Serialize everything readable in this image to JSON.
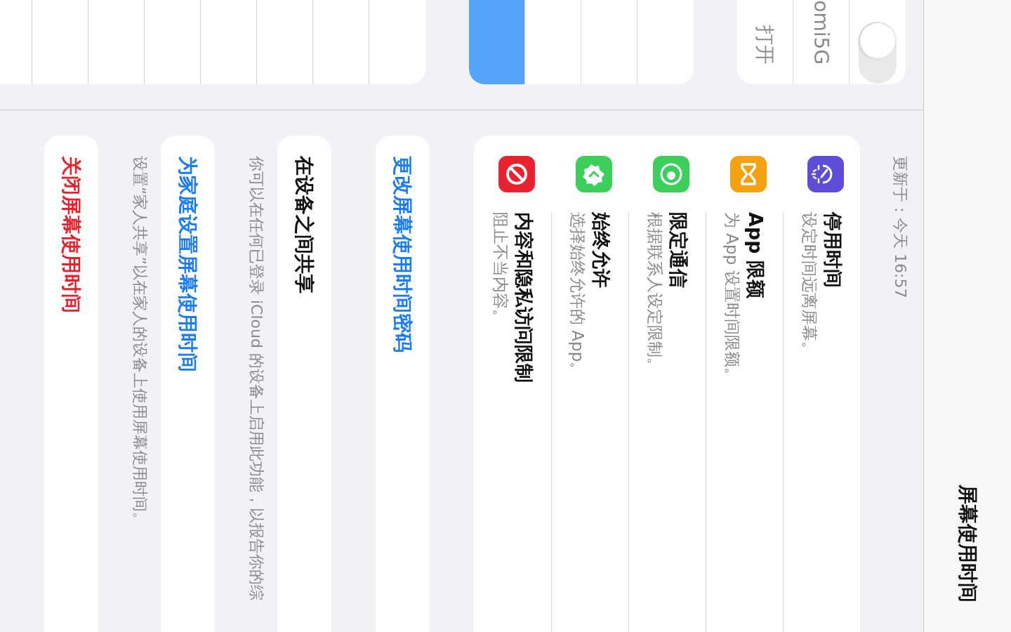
{
  "nav_bar": {
    "title": "屏幕使用时间"
  },
  "sidebar": {
    "groups": [
      {
        "rows": [
          {
            "kind": "toggle",
            "on": false
          },
          {
            "kind": "text",
            "text": "omi5G"
          },
          {
            "kind": "text",
            "text": "打开"
          }
        ]
      },
      {
        "rows": [
          {
            "kind": "blank",
            "selected": false
          },
          {
            "kind": "blank",
            "selected": false
          },
          {
            "kind": "blank",
            "selected": false
          },
          {
            "kind": "blank",
            "selected": true
          }
        ]
      },
      {
        "rows": [
          {
            "kind": "blank",
            "selected": false
          },
          {
            "kind": "blank",
            "selected": false
          },
          {
            "kind": "blank",
            "selected": false
          },
          {
            "kind": "blank",
            "selected": false
          },
          {
            "kind": "blank",
            "selected": false
          },
          {
            "kind": "blank",
            "selected": false
          },
          {
            "kind": "blank",
            "selected": false
          },
          {
            "kind": "blank",
            "selected": false
          }
        ]
      }
    ]
  },
  "updated": "更新于：今天 16:57",
  "features": [
    {
      "kind": "dial",
      "color": "#5a4fd6",
      "title": "停用时间",
      "subtitle": "设定时间远离屏幕。"
    },
    {
      "kind": "hourglass",
      "color": "#f5a00f",
      "title": "App 限额",
      "subtitle": "为 App 设置时间限额。"
    },
    {
      "kind": "contact",
      "color": "#3ccf5b",
      "title": "限定通信",
      "subtitle": "根据联系人设定限制。"
    },
    {
      "kind": "badge",
      "color": "#3ccf5b",
      "title": "始终允许",
      "subtitle": "选择始终允许的 App。"
    },
    {
      "kind": "block",
      "color": "#e8232f",
      "title": "内容和隐私访问限制",
      "subtitle": "阻止不当内容。"
    }
  ],
  "sections": [
    {
      "kind": "link",
      "text": "更改屏幕使用时间密码"
    },
    {
      "kind": "plain",
      "text": "在设备之间共享",
      "footer": "你可以在任何已登录 iCloud 的设备上启用此功能，以报告你的综"
    },
    {
      "kind": "link",
      "text": "为家庭设置屏幕使用时间",
      "footer": "设置“家人共享”以在家人的设备上使用屏幕使用时间。"
    },
    {
      "kind": "destructive",
      "text": "关闭屏幕使用时间"
    }
  ]
}
